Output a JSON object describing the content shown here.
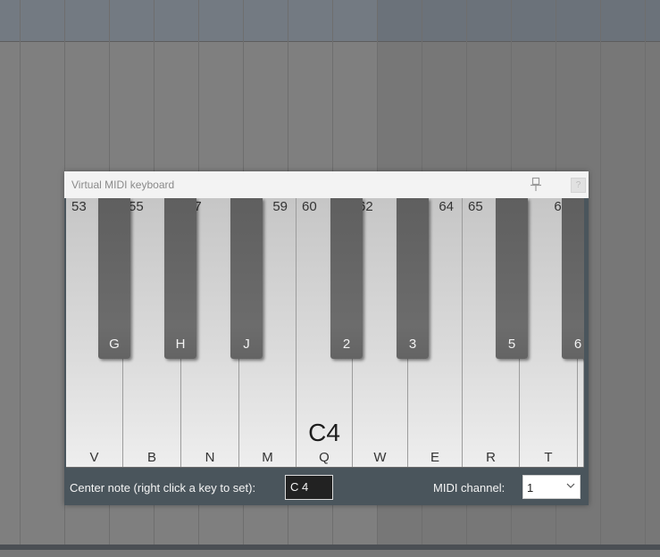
{
  "window": {
    "title": "Virtual MIDI keyboard"
  },
  "keyboard": {
    "center_note_name": "C4",
    "white_keys": [
      {
        "note": "53",
        "shortcut": "V"
      },
      {
        "note": "55",
        "shortcut": "B"
      },
      {
        "note": "57",
        "shortcut": "N"
      },
      {
        "note": "59",
        "shortcut": "M"
      },
      {
        "note": "60",
        "shortcut": "Q",
        "center": true
      },
      {
        "note": "62",
        "shortcut": "W"
      },
      {
        "note": "64",
        "shortcut": "E"
      },
      {
        "note": "65",
        "shortcut": "R"
      },
      {
        "note": "67",
        "shortcut": "T"
      },
      {
        "note": "",
        "shortcut": ""
      }
    ],
    "black_keys": [
      {
        "shortcut": "G"
      },
      {
        "shortcut": "H"
      },
      {
        "shortcut": "J"
      },
      {
        "shortcut": "2"
      },
      {
        "shortcut": "3"
      },
      {
        "shortcut": "5"
      },
      {
        "shortcut": "6"
      }
    ]
  },
  "footer": {
    "center_note_label": "Center note (right click a key to set):",
    "center_note_value": "C 4",
    "midi_channel_label": "MIDI channel:",
    "midi_channel_value": "1"
  },
  "icons": {
    "pin": "pin-icon",
    "close": "close-icon",
    "dropdown": "chevron-down-icon"
  }
}
